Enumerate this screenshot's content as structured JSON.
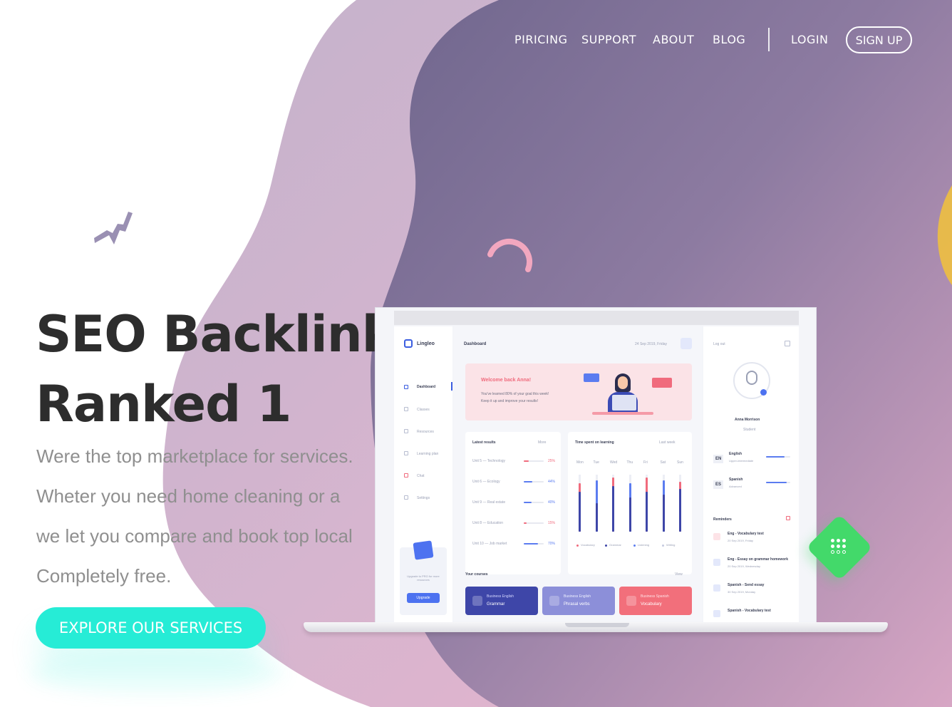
{
  "nav": {
    "items": [
      "PIRICING",
      "SUPPORT",
      "ABOUT",
      "BLOG"
    ],
    "login": "LOGIN",
    "signup": "SIGN UP"
  },
  "hero": {
    "title_line1": "SEO Backlink",
    "title_line2": "Ranked 1",
    "desc_lines": [
      "Were the top marketplace for services.",
      "Wheter you need home cleaning or a",
      "we let you compare and book top local",
      "Completely free."
    ],
    "cta": "EXPLORE OUR SERVICES"
  },
  "dashboard": {
    "brand": "Lingleo",
    "page_title": "Dashboard",
    "date": "24 Sep 2019, Friday",
    "sidebar": [
      "Dashboard",
      "Classes",
      "Resources",
      "Learning plan",
      "Chat",
      "Settings"
    ],
    "upgrade_text": "Upgrade to PRO for more resources",
    "upgrade_button": "Upgrade",
    "welcome_title": "Welcome back Anna!",
    "welcome_text_1": "You've learned 80% of your goal this week!",
    "welcome_text_2": "Keep it up and improve your results!",
    "latest_results": {
      "title": "Latest results",
      "more": "More",
      "rows": [
        {
          "label": "Unit 5 — Technology",
          "pct": 25,
          "value": "25%",
          "color": "#f06b7d"
        },
        {
          "label": "Unit 6 — Ecology",
          "pct": 44,
          "value": "44%",
          "color": "#5b7cf0"
        },
        {
          "label": "Unit 9 — Real estate",
          "pct": 40,
          "value": "40%",
          "color": "#5b7cf0"
        },
        {
          "label": "Unit 8 — Education",
          "pct": 15,
          "value": "15%",
          "color": "#f06b7d"
        },
        {
          "label": "Unit 10 — Job market",
          "pct": 70,
          "value": "70%",
          "color": "#5b7cf0"
        }
      ]
    },
    "time_spent": {
      "title": "Time spent on learning",
      "period": "Last week",
      "days": [
        "Mon",
        "Tue",
        "Wed",
        "Thu",
        "Fri",
        "Sat",
        "Sun"
      ],
      "legend": [
        "Vocabulary",
        "Grammar",
        "Listening",
        "Writing"
      ]
    },
    "courses": {
      "title": "Your courses",
      "more": "View",
      "items": [
        {
          "top": "Business English",
          "name": "Grammar",
          "color": "#3e46a8"
        },
        {
          "top": "Business English",
          "name": "Phrasal verbs",
          "color": "#8c8fd9"
        },
        {
          "top": "Business Spanish",
          "name": "Vocabulary",
          "color": "#f26f7b"
        }
      ]
    },
    "profile": {
      "logout": "Log out",
      "name": "Anna Morrison",
      "role": "Student",
      "languages": [
        {
          "code": "EN",
          "name": "English",
          "level": "Upper-intermediate",
          "pct": 75
        },
        {
          "code": "ES",
          "name": "Spanish",
          "level": "Advanced",
          "pct": 85
        }
      ],
      "reminders_title": "Reminders",
      "reminders": [
        {
          "title": "Eng - Vocabulary test",
          "date": "20 Sep 2019, Friday"
        },
        {
          "title": "Eng - Essay on grammar homework",
          "date": "20 Sep 2019, Wednesday"
        },
        {
          "title": "Spanish - Send essay",
          "date": "30 Sep 2019, Monday"
        },
        {
          "title": "Spanish - Vocabulary test",
          "date": ""
        }
      ]
    }
  },
  "colors": {
    "accent": "#26ecd6",
    "blob_dark": "#7b6f9a",
    "blob_light": "#e6a7c4",
    "dashboard_blue": "#4d72f0",
    "dashboard_pink": "#f06b7d"
  }
}
